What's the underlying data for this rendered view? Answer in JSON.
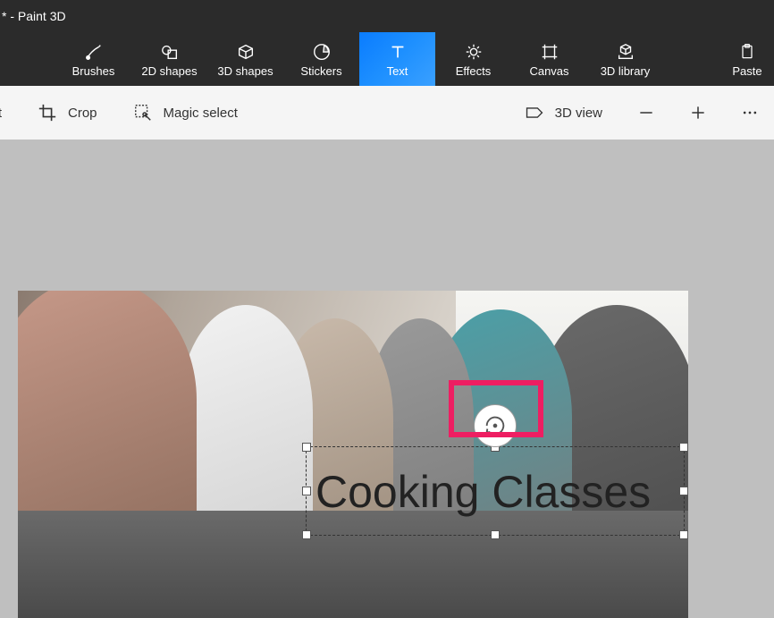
{
  "window": {
    "title": "* - Paint 3D"
  },
  "ribbon": {
    "brushes": "Brushes",
    "shapes2d": "2D shapes",
    "shapes3d": "3D shapes",
    "stickers": "Stickers",
    "text": "Text",
    "effects": "Effects",
    "canvas": "Canvas",
    "library3d": "3D library",
    "paste": "Paste"
  },
  "subbar": {
    "select": "ect",
    "crop": "Crop",
    "magic_select": "Magic select",
    "view3d": "3D view"
  },
  "text_box": {
    "content": "Cooking Classes"
  }
}
